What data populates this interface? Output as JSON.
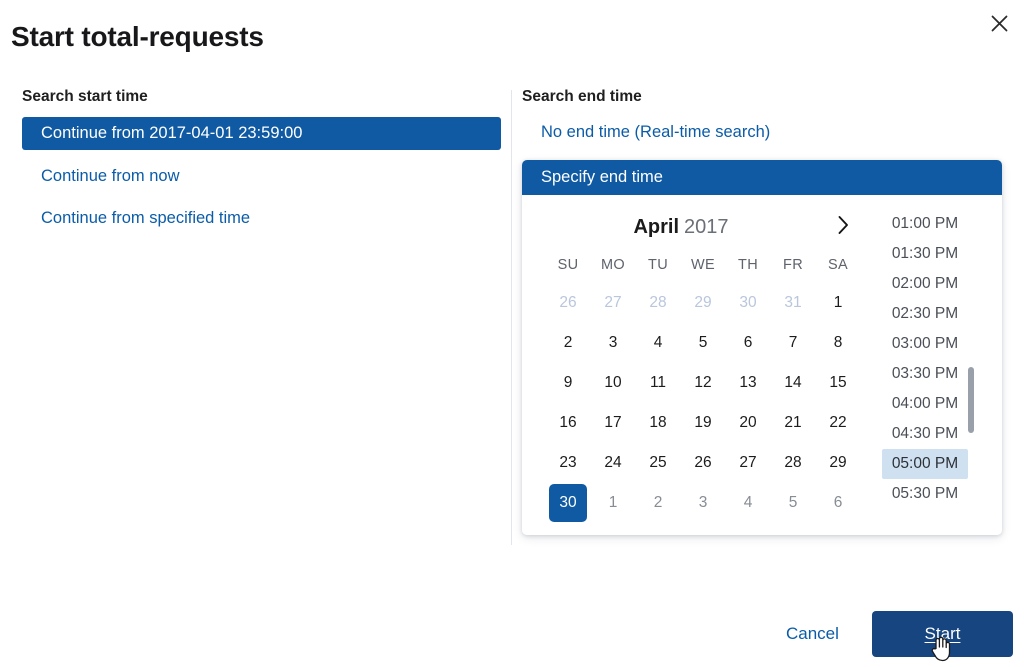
{
  "dialog": {
    "title": "Start total-requests",
    "close_icon": "close-icon"
  },
  "start_time": {
    "heading": "Search start time",
    "options": [
      {
        "label": "Continue from 2017-04-01 23:59:00",
        "selected": true
      },
      {
        "label": "Continue from now",
        "selected": false
      },
      {
        "label": "Continue from specified time",
        "selected": false
      }
    ]
  },
  "end_time": {
    "heading": "Search end time",
    "no_end_time_label": "No end time (Real-time search)",
    "specify_label": "Specify end time",
    "picker": {
      "month": "April",
      "year": "2017",
      "next_month_icon": "chevron-right-icon",
      "weekdays": [
        "SU",
        "MO",
        "TU",
        "WE",
        "TH",
        "FR",
        "SA"
      ],
      "weeks": [
        [
          {
            "d": "26",
            "m": "prev"
          },
          {
            "d": "27",
            "m": "prev"
          },
          {
            "d": "28",
            "m": "prev"
          },
          {
            "d": "29",
            "m": "prev"
          },
          {
            "d": "30",
            "m": "prev"
          },
          {
            "d": "31",
            "m": "prev"
          },
          {
            "d": "1",
            "m": "cur"
          }
        ],
        [
          {
            "d": "2",
            "m": "cur"
          },
          {
            "d": "3",
            "m": "cur"
          },
          {
            "d": "4",
            "m": "cur"
          },
          {
            "d": "5",
            "m": "cur"
          },
          {
            "d": "6",
            "m": "cur"
          },
          {
            "d": "7",
            "m": "cur"
          },
          {
            "d": "8",
            "m": "cur"
          }
        ],
        [
          {
            "d": "9",
            "m": "cur"
          },
          {
            "d": "10",
            "m": "cur"
          },
          {
            "d": "11",
            "m": "cur"
          },
          {
            "d": "12",
            "m": "cur"
          },
          {
            "d": "13",
            "m": "cur"
          },
          {
            "d": "14",
            "m": "cur"
          },
          {
            "d": "15",
            "m": "cur"
          }
        ],
        [
          {
            "d": "16",
            "m": "cur"
          },
          {
            "d": "17",
            "m": "cur"
          },
          {
            "d": "18",
            "m": "cur"
          },
          {
            "d": "19",
            "m": "cur"
          },
          {
            "d": "20",
            "m": "cur"
          },
          {
            "d": "21",
            "m": "cur"
          },
          {
            "d": "22",
            "m": "cur"
          }
        ],
        [
          {
            "d": "23",
            "m": "cur"
          },
          {
            "d": "24",
            "m": "cur"
          },
          {
            "d": "25",
            "m": "cur"
          },
          {
            "d": "26",
            "m": "cur"
          },
          {
            "d": "27",
            "m": "cur"
          },
          {
            "d": "28",
            "m": "cur"
          },
          {
            "d": "29",
            "m": "cur"
          }
        ],
        [
          {
            "d": "30",
            "m": "cur",
            "selected": true
          },
          {
            "d": "1",
            "m": "next"
          },
          {
            "d": "2",
            "m": "next"
          },
          {
            "d": "3",
            "m": "next"
          },
          {
            "d": "4",
            "m": "next"
          },
          {
            "d": "5",
            "m": "next"
          },
          {
            "d": "6",
            "m": "next"
          }
        ]
      ],
      "times": [
        {
          "label": "01:00 PM",
          "selected": false
        },
        {
          "label": "01:30 PM",
          "selected": false
        },
        {
          "label": "02:00 PM",
          "selected": false
        },
        {
          "label": "02:30 PM",
          "selected": false
        },
        {
          "label": "03:00 PM",
          "selected": false
        },
        {
          "label": "03:30 PM",
          "selected": false
        },
        {
          "label": "04:00 PM",
          "selected": false
        },
        {
          "label": "04:30 PM",
          "selected": false
        },
        {
          "label": "05:00 PM",
          "selected": true
        },
        {
          "label": "05:30 PM",
          "selected": false
        }
      ]
    }
  },
  "footer": {
    "cancel_label": "Cancel",
    "start_label": "Start"
  },
  "colors": {
    "accent_blue": "#0f5aa3",
    "link_blue": "#0b5ca8",
    "button_navy": "#17457f",
    "time_highlight": "#cfe1f0",
    "muted_prev_day": "#b9c6dd",
    "muted_next_day": "#878c95"
  }
}
